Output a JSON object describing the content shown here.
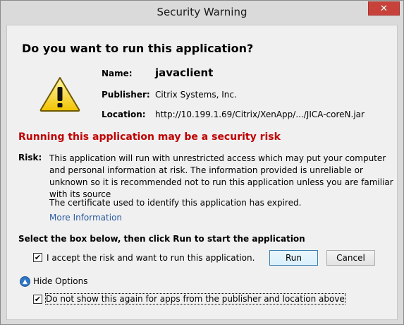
{
  "window": {
    "title": "Security Warning",
    "close_glyph": "✕"
  },
  "question": "Do you want to run this application?",
  "app": {
    "name_label": "Name:",
    "name": "javaclient",
    "publisher_label": "Publisher:",
    "publisher": "Citrix Systems, Inc.",
    "location_label": "Location:",
    "location": "http://10.199.1.69/Citrix/XenApp/.../JICA-coreN.jar"
  },
  "risk": {
    "heading": "Running this application may be a security risk",
    "label": "Risk:",
    "text": "This application will run with unrestricted access which may put your computer and personal information at risk. The information provided is unreliable or unknown so it is recommended not to run this application unless you are familiar with its source",
    "certificate_text": "The certificate used to identify this application has expired.",
    "more_info": "More Information"
  },
  "select_heading": "Select the box below, then click Run to start the application",
  "accept": {
    "label": "I accept the risk and want to run this application.",
    "checked": true
  },
  "buttons": {
    "run": "Run",
    "cancel": "Cancel"
  },
  "options": {
    "hide_label": "Hide Options",
    "icon": "chevron-up-icon"
  },
  "do_not_show": {
    "label": "Do not show this again for apps from the publisher and location above",
    "checked": true
  },
  "colors": {
    "risk_heading": "#c00000",
    "link": "#2a5aa3",
    "close_button": "#c7423a",
    "options_icon": "#2f76c4"
  },
  "icons": {
    "warning": "warning-triangle-icon",
    "check": "✔"
  }
}
